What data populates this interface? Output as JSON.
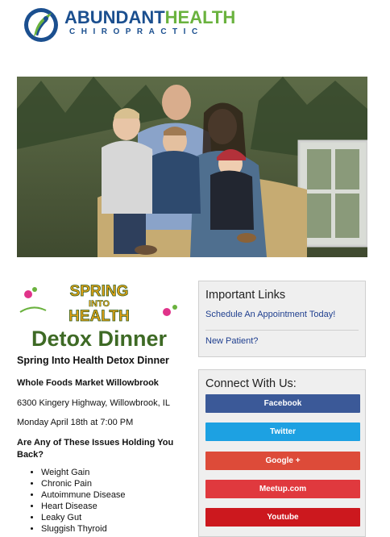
{
  "logo": {
    "name_part1": "ABUNDANT",
    "name_part2": "HEALTH",
    "tagline": "CHIROPRACTIC"
  },
  "flyer": {
    "line1": "SPRING",
    "line2": "INTO",
    "line3": "HEALTH",
    "line4": "Detox Dinner"
  },
  "event": {
    "title": "Spring Into Health Detox Dinner",
    "venue": "Whole Foods Market Willowbrook",
    "address": "6300 Kingery Highway, Willowbrook, IL",
    "datetime": "Monday April 18th at 7:00 PM",
    "question": "Are Any of These Issues Holding You Back?",
    "issues": [
      "Weight Gain",
      "Chronic Pain",
      "Autoimmune Disease",
      "Heart Disease",
      "Leaky Gut",
      "Sluggish Thyroid"
    ]
  },
  "important_links": {
    "heading": "Important Links",
    "links": [
      "Schedule An Appointment Today!",
      "New Patient?"
    ]
  },
  "connect": {
    "heading": "Connect With Us:",
    "buttons": [
      {
        "label": "Facebook",
        "color": "#3b5998"
      },
      {
        "label": "Twitter",
        "color": "#1da1e2"
      },
      {
        "label": "Google +",
        "color": "#dd4b39"
      },
      {
        "label": "Meetup.com",
        "color": "#e0393e"
      },
      {
        "label": "Youtube",
        "color": "#cc181e"
      }
    ]
  },
  "colors": {
    "brand_blue": "#1b4f8f",
    "brand_green": "#6ab23e",
    "link": "#1f3f8f"
  }
}
